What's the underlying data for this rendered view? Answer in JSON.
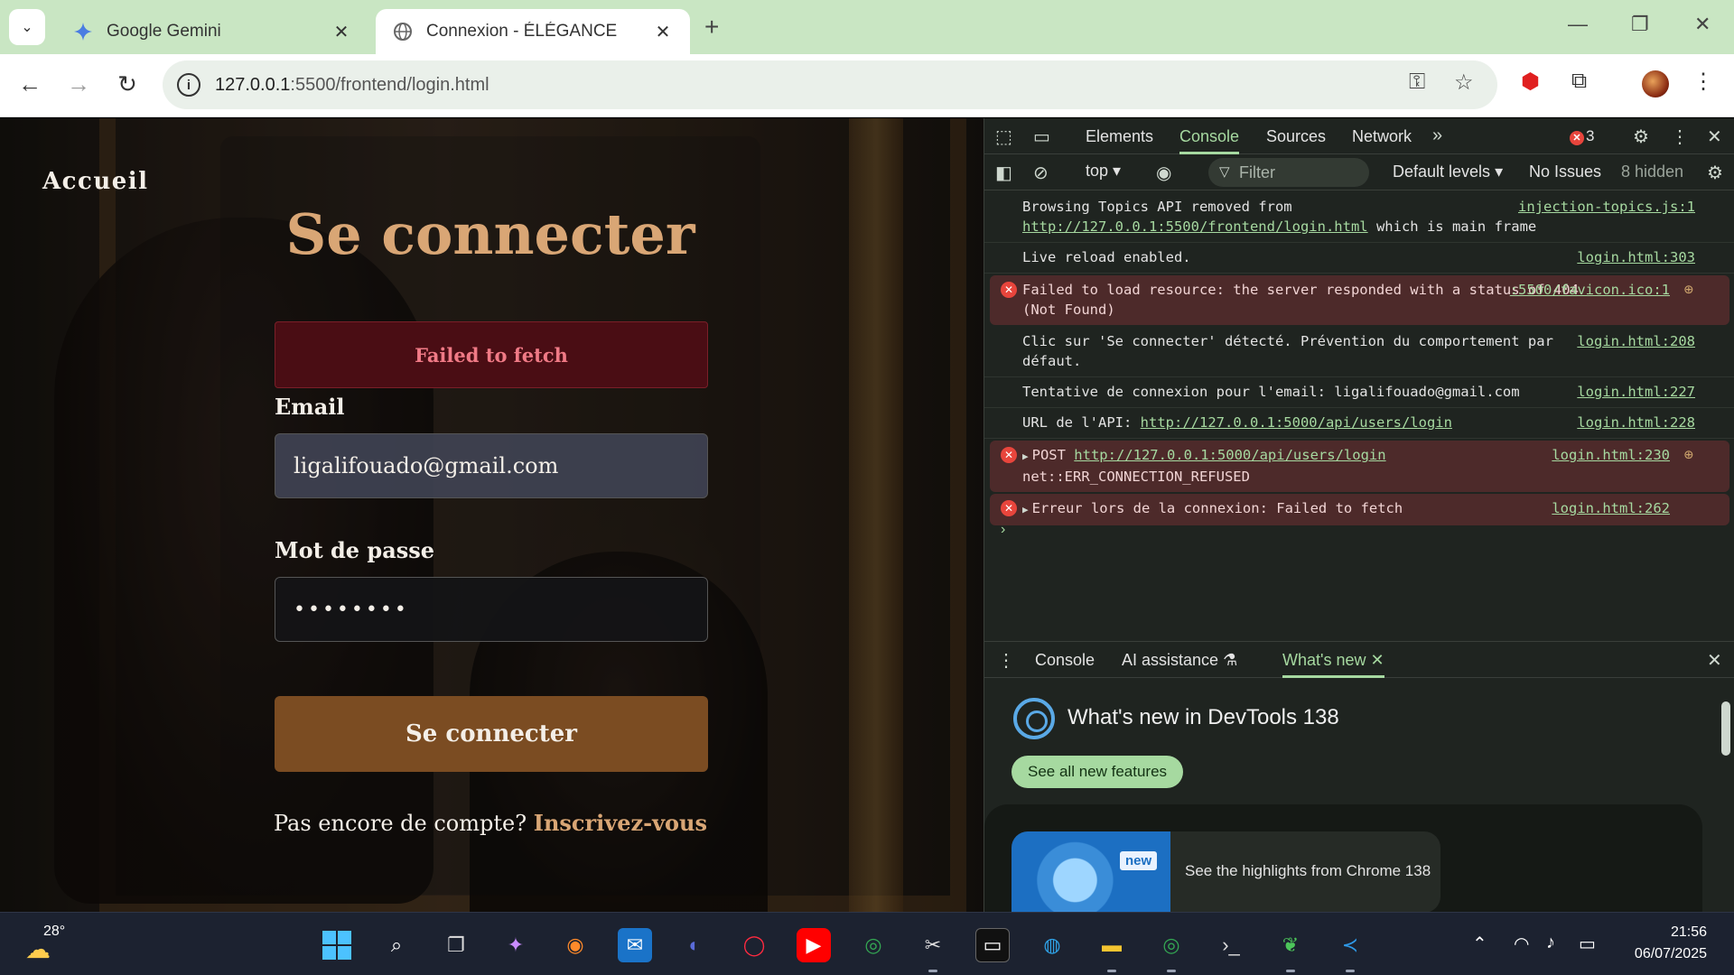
{
  "browser": {
    "tabs": [
      {
        "title": "Google Gemini"
      },
      {
        "title": "Connexion - ÉLÉGANCE"
      }
    ],
    "url_host": "127.0.0.1",
    "url_rest": ":5500/frontend/login.html"
  },
  "page": {
    "home_link": "Accueil",
    "title": "Se connecter",
    "error_message": "Failed to fetch",
    "email_label": "Email",
    "email_value": "ligalifouado@gmail.com",
    "password_label": "Mot de passe",
    "password_value": "••••••••",
    "submit_label": "Se connecter",
    "signup_prompt": "Pas encore de compte?",
    "signup_link": "Inscrivez-vous"
  },
  "devtools": {
    "tabs": [
      "Elements",
      "Console",
      "Sources",
      "Network"
    ],
    "active_tab": "Console",
    "error_count": "3",
    "context": "top",
    "filter_placeholder": "Filter",
    "levels": "Default levels",
    "issues": "No Issues",
    "hidden": "8 hidden",
    "messages": [
      {
        "type": "info",
        "text": "Browsing Topics API removed from",
        "link": "http://127.0.0.1:5500/frontend/login.html",
        "text2": "which is main frame",
        "source": "injection-topics.js:1"
      },
      {
        "type": "info",
        "text": "Live reload enabled.",
        "source": "login.html:303"
      },
      {
        "type": "error",
        "text": "Failed to load resource: the server responded with a status of 404 (Not Found)",
        "source": ":5500/favicon.ico:1"
      },
      {
        "type": "info",
        "text": "Clic sur 'Se connecter' détecté. Prévention du comportement par défaut.",
        "source": "login.html:208"
      },
      {
        "type": "info",
        "text": "Tentative de connexion pour l'email: ligalifouado@gmail.com",
        "source": "login.html:227"
      },
      {
        "type": "info",
        "text": "URL de l'API:",
        "link": "http://127.0.0.1:5000/api/users/login",
        "source": "login.html:228"
      },
      {
        "type": "error",
        "text": "POST",
        "link": "http://127.0.0.1:5000/api/users/login",
        "text2": "net::ERR_CONNECTION_REFUSED",
        "source": "login.html:230"
      },
      {
        "type": "error",
        "text": "Erreur lors de la connexion: Failed to fetch",
        "source": "login.html:262"
      }
    ],
    "drawer_tabs": [
      "Console",
      "AI assistance",
      "What's new"
    ],
    "whats_new_title": "What's new in DevTools 138",
    "whats_new_button": "See all new features",
    "new_badge": "new",
    "highlight_text": "See the highlights from Chrome 138"
  },
  "taskbar": {
    "temperature": "28°",
    "time": "21:56",
    "date": "06/07/2025"
  }
}
